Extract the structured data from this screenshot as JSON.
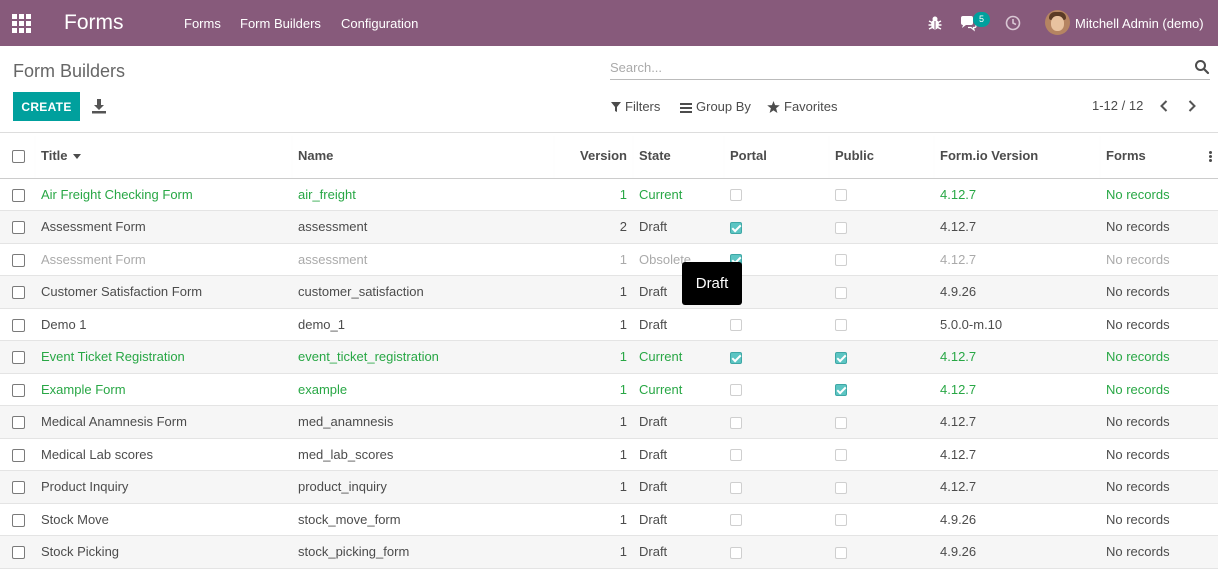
{
  "navbar": {
    "app_title": "Forms",
    "menu": [
      "Forms",
      "Form Builders",
      "Configuration"
    ],
    "messages_count": "5",
    "user_name": "Mitchell Admin (demo)"
  },
  "control_panel": {
    "breadcrumb": "Form Builders",
    "search_placeholder": "Search...",
    "create_label": "CREATE",
    "filters_label": "Filters",
    "groupby_label": "Group By",
    "favorites_label": "Favorites",
    "pager": "1-12 / 12"
  },
  "table": {
    "columns": [
      "Title",
      "Name",
      "Version",
      "State",
      "Portal",
      "Public",
      "Form.io Version",
      "Forms"
    ],
    "rows": [
      {
        "title": "Air Freight Checking Form",
        "name": "air_freight",
        "version": "1",
        "state": "Current",
        "portal": false,
        "public": false,
        "formio": "4.12.7",
        "forms": "No records"
      },
      {
        "title": "Assessment Form",
        "name": "assessment",
        "version": "2",
        "state": "Draft",
        "portal": true,
        "public": false,
        "formio": "4.12.7",
        "forms": "No records"
      },
      {
        "title": "Assessment Form",
        "name": "assessment",
        "version": "1",
        "state": "Obsolete",
        "portal": true,
        "public": false,
        "formio": "4.12.7",
        "forms": "No records"
      },
      {
        "title": "Customer Satisfaction Form",
        "name": "customer_satisfaction",
        "version": "1",
        "state": "Draft",
        "portal": false,
        "public": false,
        "formio": "4.9.26",
        "forms": "No records"
      },
      {
        "title": "Demo 1",
        "name": "demo_1",
        "version": "1",
        "state": "Draft",
        "portal": false,
        "public": false,
        "formio": "5.0.0-m.10",
        "forms": "No records"
      },
      {
        "title": "Event Ticket Registration",
        "name": "event_ticket_registration",
        "version": "1",
        "state": "Current",
        "portal": true,
        "public": true,
        "formio": "4.12.7",
        "forms": "No records"
      },
      {
        "title": "Example Form",
        "name": "example",
        "version": "1",
        "state": "Current",
        "portal": false,
        "public": true,
        "formio": "4.12.7",
        "forms": "No records"
      },
      {
        "title": "Medical Anamnesis Form",
        "name": "med_anamnesis",
        "version": "1",
        "state": "Draft",
        "portal": false,
        "public": false,
        "formio": "4.12.7",
        "forms": "No records"
      },
      {
        "title": "Medical Lab scores",
        "name": "med_lab_scores",
        "version": "1",
        "state": "Draft",
        "portal": false,
        "public": false,
        "formio": "4.12.7",
        "forms": "No records"
      },
      {
        "title": "Product Inquiry",
        "name": "product_inquiry",
        "version": "1",
        "state": "Draft",
        "portal": false,
        "public": false,
        "formio": "4.12.7",
        "forms": "No records"
      },
      {
        "title": "Stock Move",
        "name": "stock_move_form",
        "version": "1",
        "state": "Draft",
        "portal": false,
        "public": false,
        "formio": "4.9.26",
        "forms": "No records"
      },
      {
        "title": "Stock Picking",
        "name": "stock_picking_form",
        "version": "1",
        "state": "Draft",
        "portal": false,
        "public": false,
        "formio": "4.9.26",
        "forms": "No records"
      }
    ]
  },
  "tooltip": {
    "text": "Draft"
  },
  "colors": {
    "navbar": "#875a7b",
    "primary": "#00a09d",
    "current_state": "#28a745",
    "obsolete_state": "#aaaaaa"
  }
}
